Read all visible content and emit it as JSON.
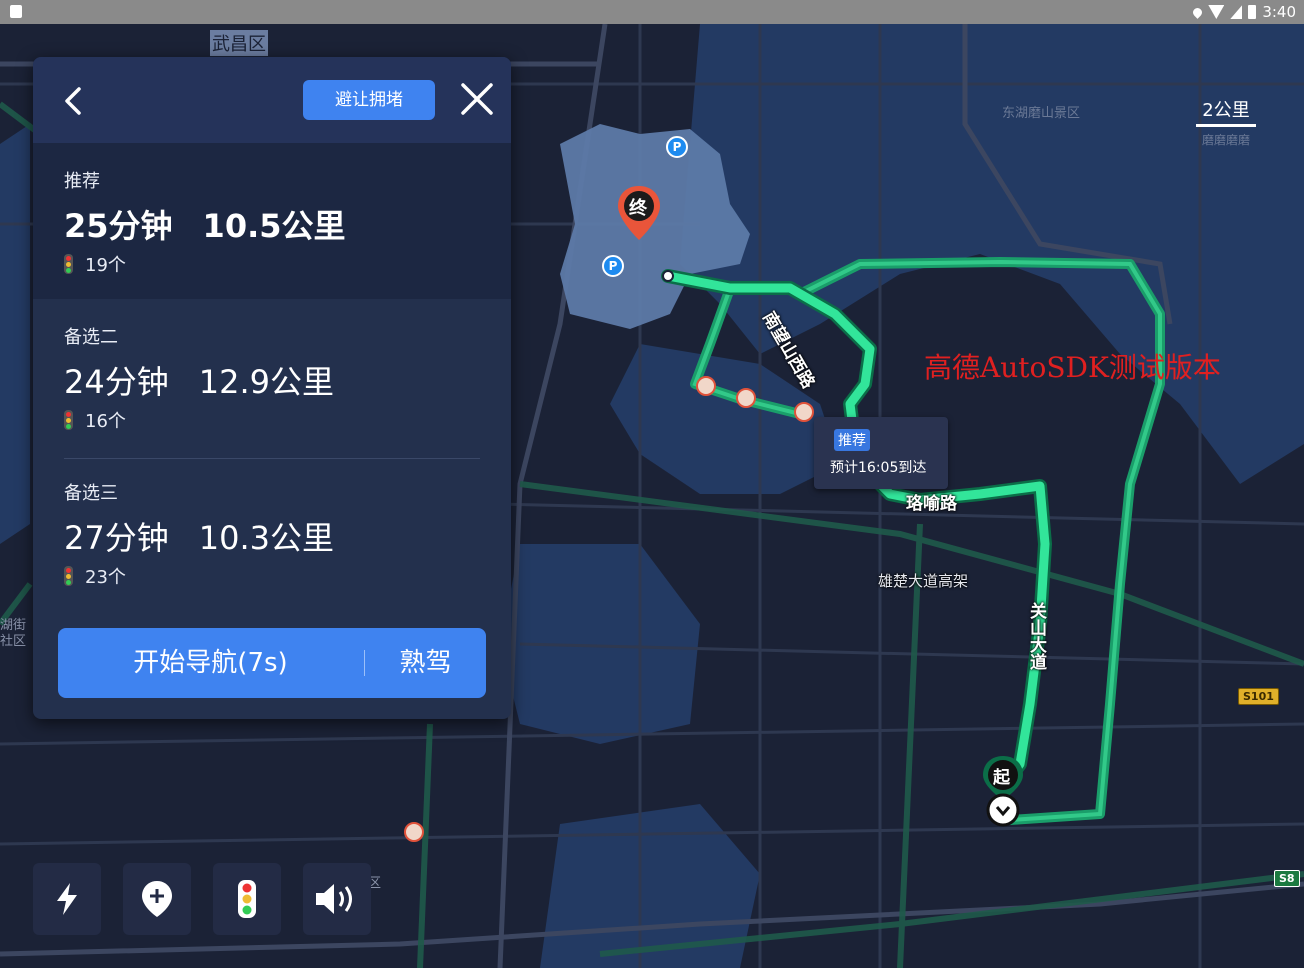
{
  "status_bar": {
    "time": "3:40"
  },
  "map": {
    "district_label": "武昌区",
    "scenic_label": "东湖磨山景区",
    "left_edge_label_1": "湖街",
    "left_edge_label_2": "社区",
    "bottom_label": "区",
    "scale": {
      "value": "2公里",
      "sub": "磨磨磨磨"
    },
    "watermark": "高德AutoSDK测试版本",
    "roads": {
      "r1": "南望山西路",
      "r2": "珞喻路",
      "r3": "雄楚大道高架",
      "r4": "关山大道"
    },
    "shields": {
      "s101": "S101",
      "s8": "S8"
    },
    "end_pin": "终",
    "start_pin": "起",
    "parking_glyph": "P",
    "tooltip": {
      "tag": "推荐",
      "eta": "预计16:05到达"
    },
    "colors": {
      "route_main": "#32e59a",
      "route_alt": "#1a9e6a",
      "water": "#233a63",
      "poi_area": "#5d7aa8"
    }
  },
  "panel": {
    "back_icon": "back-arrow-icon",
    "avoid_button": "避让拥堵",
    "close_icon": "close-icon",
    "routes": [
      {
        "name": "推荐",
        "time": "25分钟",
        "distance": "10.5公里",
        "lights": "19个"
      },
      {
        "name": "备选二",
        "time": "24分钟",
        "distance": "12.9公里",
        "lights": "16个"
      },
      {
        "name": "备选三",
        "time": "27分钟",
        "distance": "10.3公里",
        "lights": "23个"
      }
    ],
    "start_nav": "开始导航(7s)",
    "familiar_drive": "熟驾"
  },
  "toolbar": [
    "lightning-icon",
    "add-location-icon",
    "traffic-light-icon",
    "volume-icon"
  ]
}
